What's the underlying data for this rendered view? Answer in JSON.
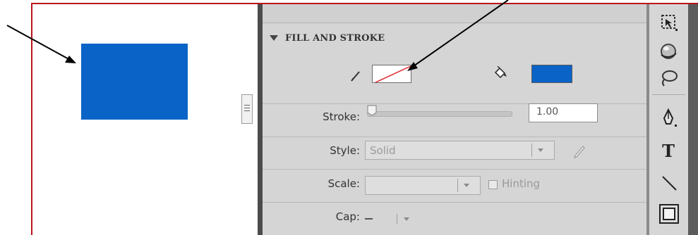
{
  "panel": {
    "section_title": "FILL AND STROKE",
    "stroke_label": "Stroke:",
    "stroke_value": "1.00",
    "style_label": "Style:",
    "style_value": "Solid",
    "scale_label": "Scale:",
    "scale_value": "",
    "hinting_label": "Hinting",
    "hinting_checked": false,
    "cap_label": "Cap:",
    "fill_color": "#0a63c7",
    "stroke_color": "none"
  },
  "stage": {
    "shape_color": "#0a63c7"
  },
  "toolbar": {
    "tools": [
      "3d-selection-icon",
      "3d-rotation-icon",
      "lasso-icon",
      "pen-icon",
      "text-tool-icon",
      "line-icon",
      "rectangle-icon"
    ],
    "text_tool_glyph": "T"
  },
  "annotations": {
    "callout_color": "#b8161c"
  }
}
